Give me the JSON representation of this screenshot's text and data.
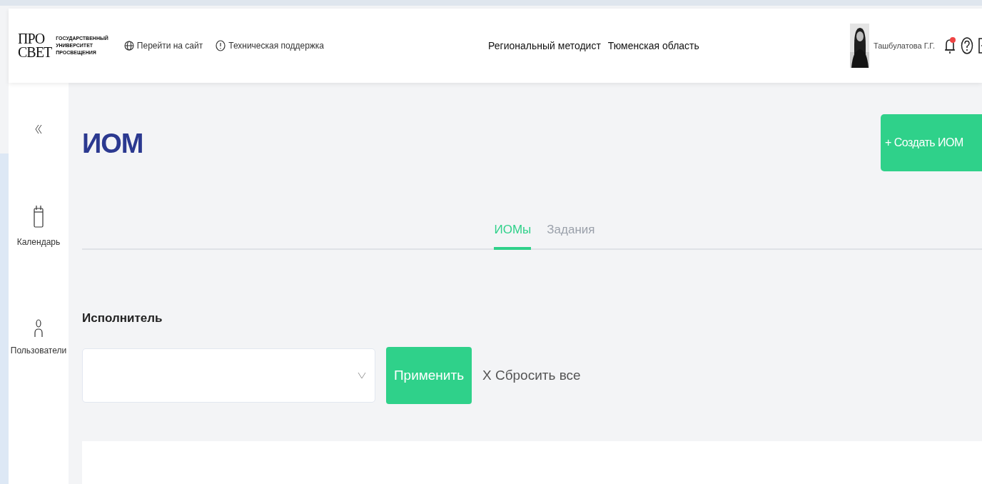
{
  "header": {
    "logo": {
      "mark_top": "ПРО",
      "mark_bottom": "СВЕТ",
      "caption": [
        "ГОСУДАРСТВЕННЫЙ",
        "УНИВЕРСИТЕТ",
        "ПРОСВЕЩЕНИЯ"
      ]
    },
    "links": [
      {
        "label": "Перейти на сайт"
      },
      {
        "label": "Техническая поддержка"
      }
    ],
    "role": "Региональный методист",
    "region": "Тюменская область",
    "user": {
      "name": "Ташбулатова Г.Г.",
      "has_notifications": true
    }
  },
  "sidebar": {
    "items": [
      {
        "label": "Календарь"
      },
      {
        "label": "Пользователи"
      }
    ]
  },
  "page": {
    "title": "ИОМ",
    "create_button": "+ Создать ИОМ",
    "tabs": [
      {
        "label": "ИОМы",
        "selected": true
      },
      {
        "label": "Задания",
        "selected": false
      }
    ],
    "filter": {
      "label": "Исполнитель",
      "apply": "Применить",
      "reset": "X Сбросить все"
    }
  }
}
